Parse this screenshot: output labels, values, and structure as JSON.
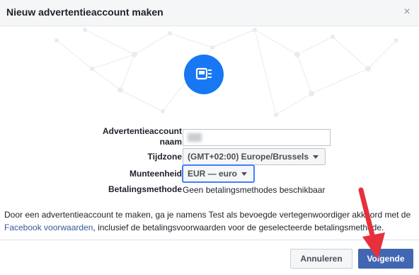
{
  "dialog": {
    "title": "Nieuw advertentieaccount maken",
    "close_symbol": "×"
  },
  "hero": {
    "icon": "ad-account-icon",
    "color": "#1877f2"
  },
  "form": {
    "name_label_line1": "Advertentieaccount",
    "name_label_line2": "naam",
    "name_value": "",
    "timezone_label": "Tijdzone",
    "timezone_value": "(GMT+02:00) Europe/Brussels",
    "currency_label": "Munteenheid",
    "currency_value": "EUR — euro",
    "payment_label": "Betalingsmethode",
    "payment_value": "Geen betalingsmethodes beschikbaar"
  },
  "description": {
    "before": "Door een advertentieaccount te maken, ga je namens Test als bevoegde vertegenwoordiger akkoord met de",
    "link": "Facebook voorwaarden",
    "after": ", inclusief de betalingsvoorwaarden voor de geselecteerde betalingsmethode."
  },
  "buttons": {
    "cancel": "Annuleren",
    "next": "Volgende"
  },
  "colors": {
    "primary": "#4267b2",
    "accent_arrow": "#e8303b",
    "link": "#385898"
  }
}
